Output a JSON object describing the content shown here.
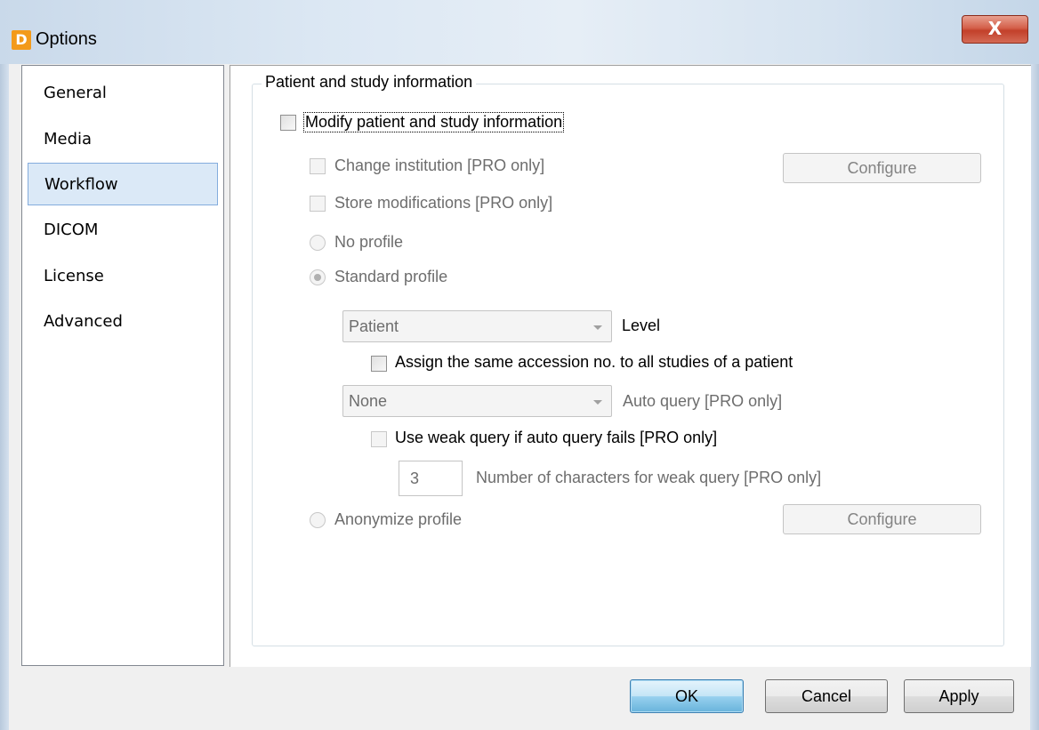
{
  "window": {
    "title": "Options",
    "app_icon_letter": "D",
    "close_glyph": "X"
  },
  "sidebar": {
    "items": [
      {
        "label": "General",
        "selected": false
      },
      {
        "label": "Media",
        "selected": false
      },
      {
        "label": "Workflow",
        "selected": true
      },
      {
        "label": "DICOM",
        "selected": false
      },
      {
        "label": "License",
        "selected": false
      },
      {
        "label": "Advanced",
        "selected": false
      }
    ]
  },
  "group": {
    "title": "Patient and study information",
    "modify_label": "Modify patient and study information",
    "change_institution_label": "Change institution [PRO only]",
    "configure_label": "Configure",
    "store_modifications_label": "Store modifications [PRO only]",
    "no_profile_label": "No profile",
    "standard_profile_label": "Standard profile",
    "level_value": "Patient",
    "level_label": "Level",
    "assign_accession_label": "Assign the same accession no. to all studies of a patient",
    "auto_query_value": "None",
    "auto_query_label": "Auto query [PRO only]",
    "weak_query_label": "Use weak query if auto query fails [PRO only]",
    "weak_chars_value": "3",
    "weak_chars_label": "Number of characters for weak query [PRO only]",
    "anonymize_profile_label": "Anonymize profile",
    "configure2_label": "Configure"
  },
  "footer": {
    "ok_label": "OK",
    "cancel_label": "Cancel",
    "apply_label": "Apply"
  }
}
